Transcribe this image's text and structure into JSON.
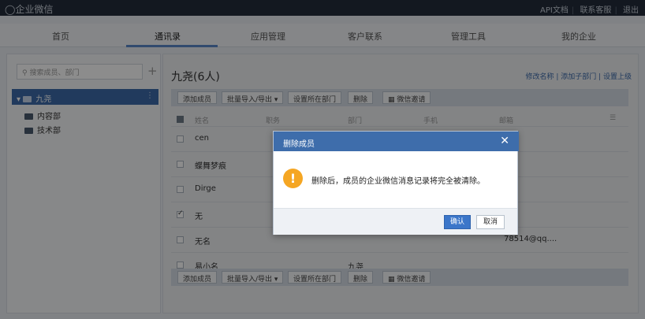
{
  "topbar": {
    "logo": "企业微信",
    "links": [
      "API文档",
      "联系客服",
      "退出"
    ]
  },
  "nav": {
    "tabs": [
      "首页",
      "通讯录",
      "应用管理",
      "客户联系",
      "管理工具",
      "我的企业"
    ],
    "active": "通讯录"
  },
  "sidebar": {
    "search_placeholder": "搜索成员、部门",
    "plus": "+",
    "root": "九尧",
    "children": [
      "内容部",
      "技术部"
    ]
  },
  "main": {
    "dept_title": "九尧(6人)",
    "right_links": "修改名称 | 添加子部门 | 设置上级",
    "toolbar": {
      "add": "添加成员",
      "import": "批量导入/导出 ▾",
      "set_dept": "设置所在部门",
      "delete": "删除",
      "invite": "微信邀请"
    },
    "columns": [
      "姓名",
      "职务",
      "部门",
      "手机",
      "邮箱"
    ],
    "rows": [
      {
        "name": "cen",
        "dept": "",
        "email": ""
      },
      {
        "name": "蝶舞梦痕",
        "dept": "",
        "email": ""
      },
      {
        "name": "Dirge",
        "dept": "",
        "email": ""
      },
      {
        "name": "无",
        "dept": "",
        "email": ""
      },
      {
        "name": "无名",
        "dept": "",
        "email": "78514@qq...."
      },
      {
        "name": "易小名",
        "dept": "九尧",
        "email": ""
      }
    ]
  },
  "dialog": {
    "title": "删除成员",
    "close": "✕",
    "icon": "!",
    "message": "删除后，成员的企业微信消息记录将完全被清除。",
    "ok": "确认",
    "cancel": "取消"
  }
}
